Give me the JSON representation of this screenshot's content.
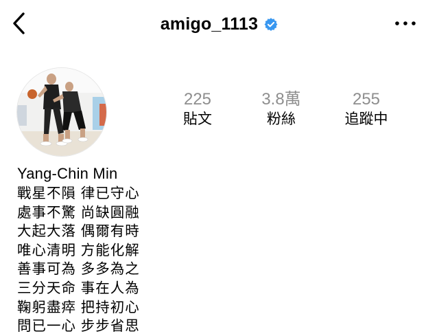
{
  "header": {
    "username": "amigo_1113",
    "verified": true,
    "back_icon": "chevron-left-icon",
    "more_icon": "more-horizontal-icon",
    "verified_color": "#3897f0"
  },
  "profile": {
    "avatar": "profile-photo-basketball-players",
    "stats": {
      "posts_value": "225",
      "posts_label": "貼文",
      "followers_value": "3.8萬",
      "followers_label": "粉絲",
      "following_value": "255",
      "following_label": "追蹤中"
    },
    "display_name": "Yang-Chin Min",
    "bio_lines": [
      "戰星不隕 律已守心",
      "處事不驚 尚缺圓融",
      "大起大落 偶爾有時",
      "唯心清明 方能化解",
      "善事可為 多多為之",
      "三分天命 事在人為",
      "鞠躬盡瘁 把持初心",
      "問已一心 步步省思"
    ]
  }
}
